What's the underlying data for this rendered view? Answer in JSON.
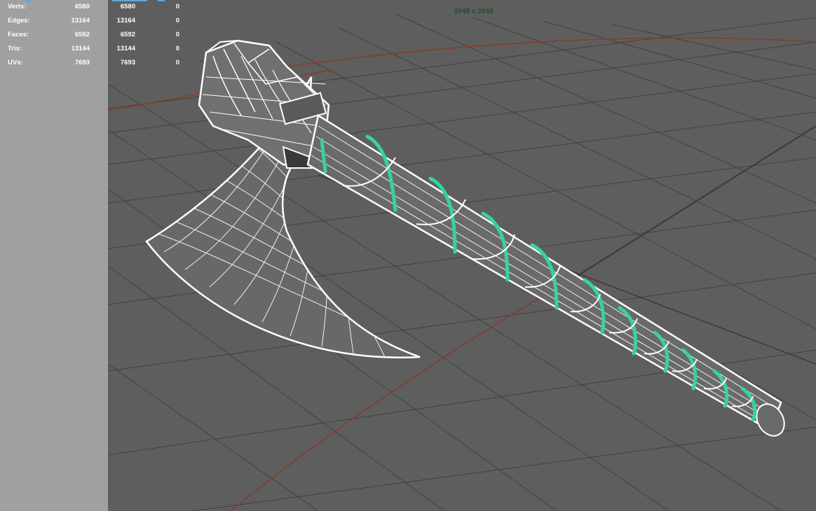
{
  "hud": {
    "rows": [
      {
        "label": "Verts:",
        "total": "6580",
        "selected": "6580",
        "count": "0"
      },
      {
        "label": "Edges:",
        "total": "13164",
        "selected": "13164",
        "count": "0"
      },
      {
        "label": "Faces:",
        "total": "6592",
        "selected": "6592",
        "count": "0"
      },
      {
        "label": "Tris:",
        "total": "13144",
        "selected": "13144",
        "count": "0"
      },
      {
        "label": "UVs:",
        "total": "7693",
        "selected": "7693",
        "count": "0"
      }
    ]
  },
  "viewport": {
    "resolution_gate": "2048 x 2048"
  },
  "colors": {
    "panel": "#a0a0a0",
    "viewport_bg": "#5e5e5e",
    "grid": "#3f3f3f",
    "axis_line": "#8a3a24",
    "wireframe": "#ffffff",
    "selected_wrap": "#37d39a",
    "resolution_text": "#1f4f2f"
  }
}
